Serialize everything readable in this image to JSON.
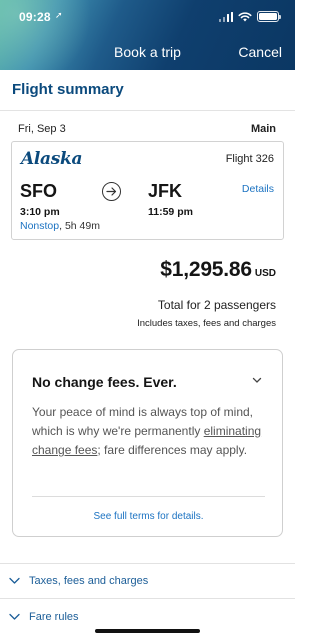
{
  "status_bar": {
    "time": "09:28",
    "location_icon": "location-arrow-icon",
    "signal_icon": "cellular-signal-icon",
    "wifi_icon": "wifi-icon",
    "battery_icon": "battery-icon",
    "battery_level": 1.0
  },
  "header": {
    "title": "Book a trip",
    "cancel_label": "Cancel",
    "gradient_colors": [
      "#5ab7a8",
      "#1f5b8a",
      "#0b3763"
    ]
  },
  "summary": {
    "title": "Flight summary",
    "date": "Fri, Sep 3",
    "fare_class": "Main"
  },
  "flight": {
    "airline": "Alaska",
    "flight_number": "Flight 326",
    "origin": "SFO",
    "destination": "JFK",
    "depart_time": "3:10 pm",
    "arrive_time": "11:59 pm",
    "stops": "Nonstop",
    "duration": ", 5h 49m",
    "details_label": "Details",
    "arrow_icon": "arrow-right-circle-icon"
  },
  "price": {
    "amount": "$1,295.86",
    "currency": "USD",
    "total_text": "Total for 2 passengers",
    "includes_text": "Includes taxes, fees and charges"
  },
  "fees_card": {
    "heading": "No change fees. Ever.",
    "chevron_icon": "chevron-down-icon",
    "body_before": "Your peace of mind is always top of mind, which is why we're permanently ",
    "body_link": "eliminating change fees",
    "body_after": "; fare differences may apply.",
    "terms_link": "See full terms for details."
  },
  "sections": [
    {
      "label": "Taxes, fees and charges",
      "icon": "chevron-down-icon"
    },
    {
      "label": "Fare rules",
      "icon": "chevron-down-icon"
    }
  ],
  "colors": {
    "brand_blue": "#0b4a7d",
    "link_blue": "#1c73c2",
    "accordion_blue": "#1c5e98"
  }
}
